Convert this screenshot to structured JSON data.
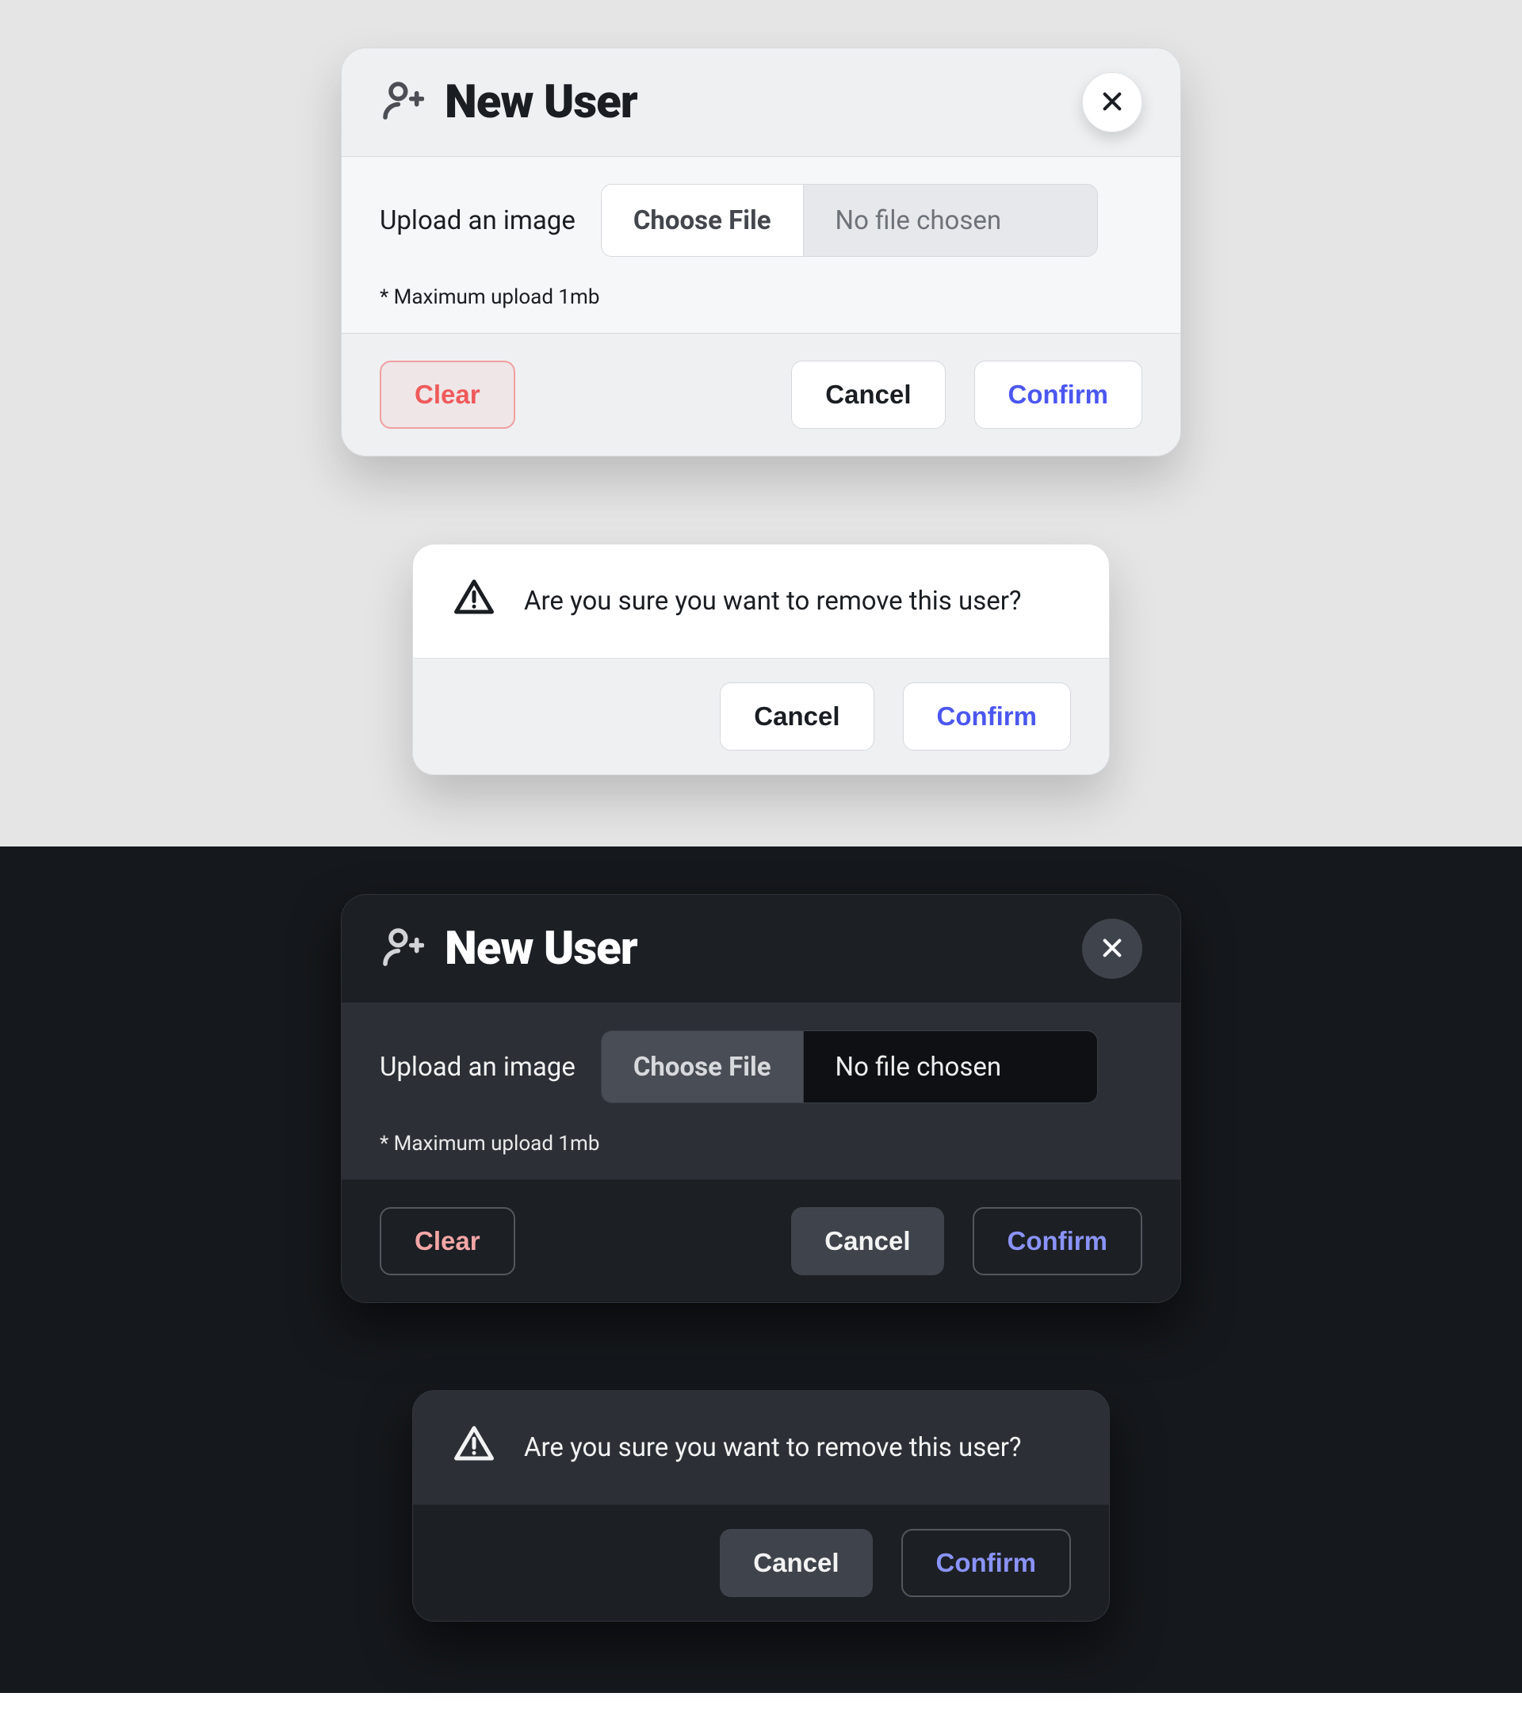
{
  "newUser": {
    "title": "New User",
    "uploadLabel": "Upload an image",
    "chooseFile": "Choose File",
    "fileStatus": "No file chosen",
    "helper": "* Maximum upload 1mb",
    "clear": "Clear",
    "cancel": "Cancel",
    "confirm": "Confirm"
  },
  "alert": {
    "message": "Are you sure you want to remove this user?",
    "cancel": "Cancel",
    "confirm": "Confirm"
  },
  "colors": {
    "accent": "#4b57f0",
    "danger": "#ef5a5a"
  }
}
